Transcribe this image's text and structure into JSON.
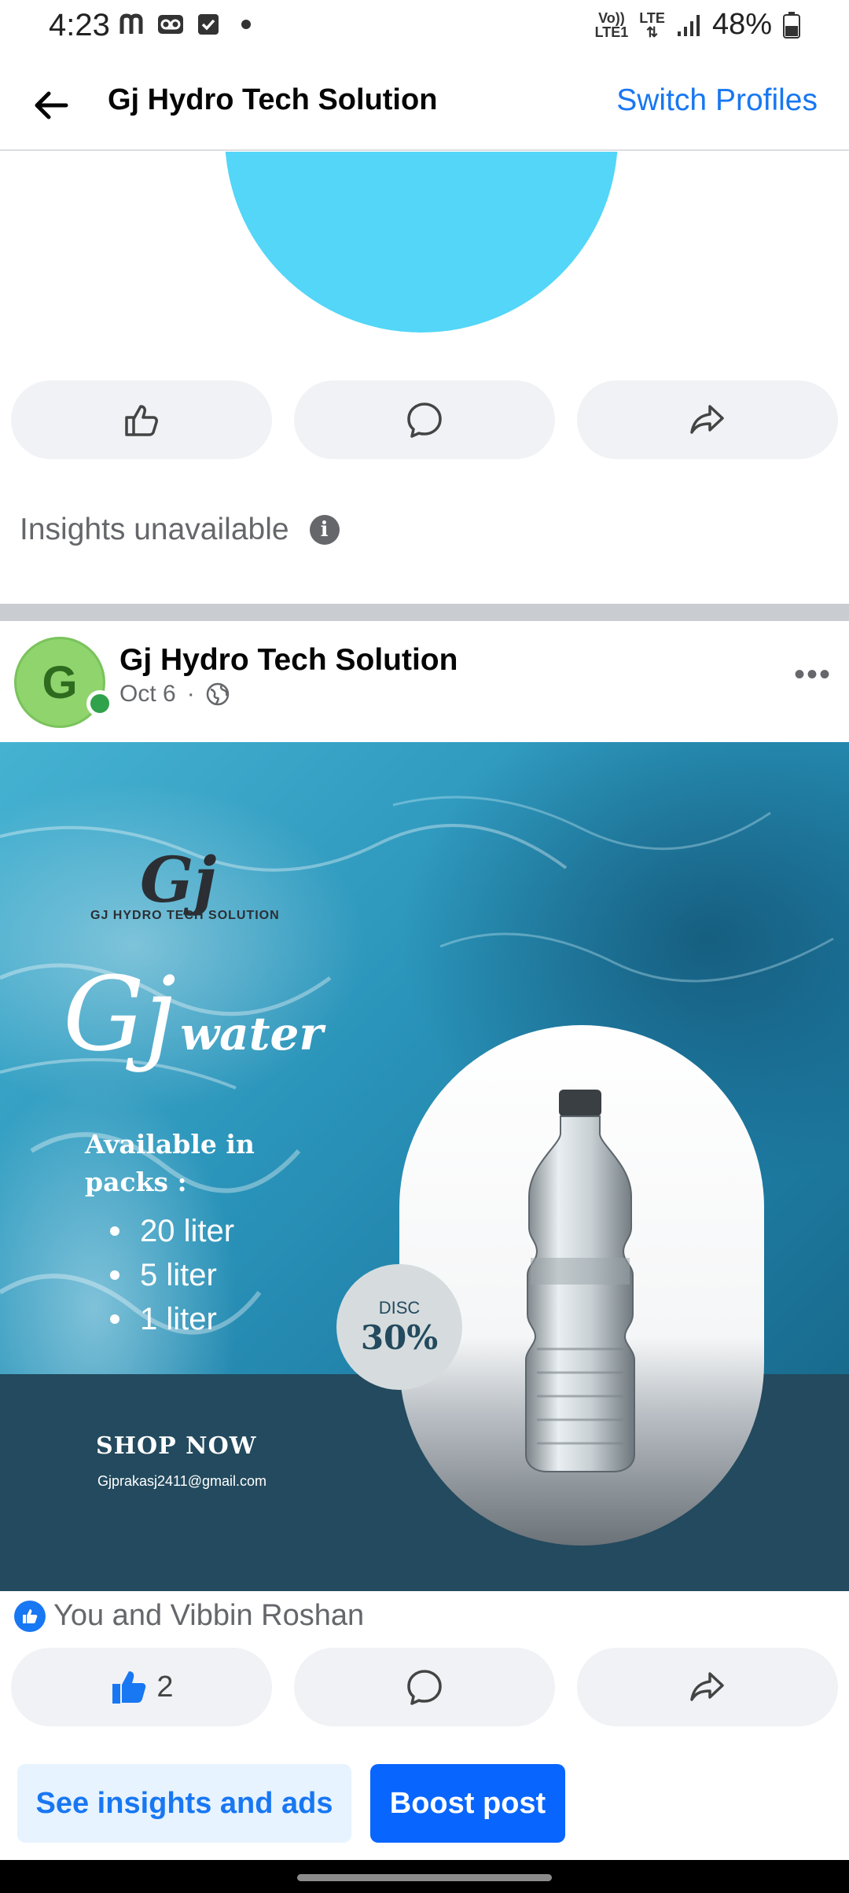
{
  "status_bar": {
    "time": "4:23",
    "battery": "48%",
    "net_top": "Vo))",
    "net_bottom": "LTE1",
    "lte": "LTE"
  },
  "header": {
    "title": "Gj Hydro Tech Solution",
    "switch_label": "Switch Profiles"
  },
  "top_post": {
    "insights_text": "Insights unavailable"
  },
  "post": {
    "author": "Gj Hydro Tech Solution",
    "avatar_letter": "G",
    "date": "Oct 6",
    "separator": "·",
    "more": "•••",
    "image": {
      "logo_mark": "Gj",
      "logo_text": "GJ HYDRO TECH SOLUTION",
      "brand_gj": "Gj",
      "brand_water": "water",
      "available_text": "Available in packs :",
      "packs": [
        "20 liter",
        "5 liter",
        "1 liter"
      ],
      "disc_label": "DISC",
      "disc_value": "30%",
      "shop_now": "SHOP NOW",
      "email": "Gjprakasj2411@gmail.com"
    },
    "reactions_text": "You and Vibbin Roshan",
    "like_count": "2"
  },
  "actions": {
    "insights_button": "See insights and ads",
    "boost_button": "Boost post"
  },
  "colors": {
    "accent": "#1877f2",
    "boost": "#0866ff",
    "online": "#31a24c",
    "band": "#234a5e"
  },
  "icons": [
    "back-arrow-icon",
    "like-icon",
    "comment-icon",
    "share-icon",
    "info-icon",
    "globe-icon",
    "more-icon"
  ]
}
